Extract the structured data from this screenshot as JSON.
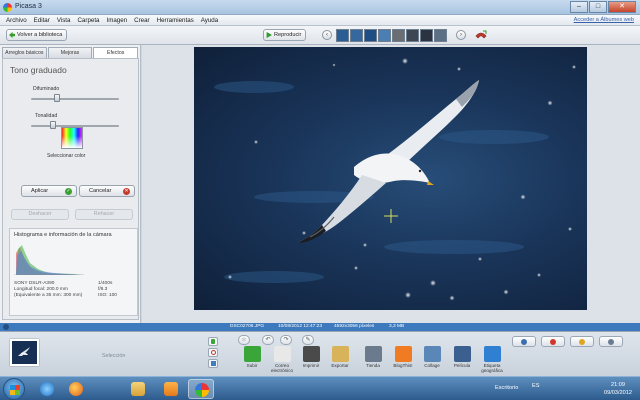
{
  "window": {
    "title": "Picasa 3",
    "controls": {
      "minimize": "–",
      "maximize": "□",
      "close": "✕"
    }
  },
  "menu": {
    "items": [
      "Archivo",
      "Editar",
      "Vista",
      "Carpeta",
      "Imagen",
      "Crear",
      "Herramientas",
      "Ayuda"
    ],
    "signin": "Acceder a Álbumes web"
  },
  "toolbar": {
    "back_label": "Volver a biblioteca",
    "play_label": "Reproducir",
    "prev": "‹",
    "next": "›"
  },
  "edit_panel": {
    "tabs": [
      "Arreglos básicos",
      "Mejoras",
      "Efectos"
    ],
    "active_tab": "Efectos",
    "effect_title": "Tono graduado",
    "slider1_label": "Difuminado",
    "slider1_value": 0.3,
    "slider2_label": "Tonalidad",
    "slider2_value": 0.25,
    "color_label": "Seleccionar color",
    "apply_label": "Aplicar",
    "cancel_label": "Cancelar",
    "undo_label": "Deshacer",
    "redo_label": "Rehacer",
    "histogram_title": "Histograma e información de la cámara",
    "camera": {
      "model": "SONY  DSLR-A390",
      "focal": "Longitud focal: 200.0 mm",
      "equiv": "(Equivalente a 35 mm: 300 mm)",
      "shutter": "1/400s",
      "aperture": "f/8.3",
      "iso": "ISO: 100"
    }
  },
  "info_bar": {
    "filename": "DSC02706.JPG",
    "datetime": "10/08/2012 12:47:23",
    "dimensions": "4592x3056 píxeles",
    "filesize": "3,3 MB"
  },
  "tray": {
    "selection_label": "Selección",
    "tools": [
      {
        "label": "Subir",
        "color": "#3aa63a"
      },
      {
        "label": "Correo electrónico",
        "color": "#e8e8e8"
      },
      {
        "label": "Imprimir",
        "color": "#4a4a4a"
      },
      {
        "label": "Exportar",
        "color": "#d9b35a"
      },
      {
        "label": "Tienda",
        "color": "#6b7a8c"
      },
      {
        "label": "BlogThis!",
        "color": "#f07b22"
      },
      {
        "label": "Collage",
        "color": "#5a87b8"
      },
      {
        "label": "Película",
        "color": "#3b5f8f"
      },
      {
        "label": "Etiqueta geográfica",
        "color": "#2f7fd3"
      }
    ]
  },
  "taskbar": {
    "desktop_label": "Escritorio",
    "language": "ES",
    "time": "21:09",
    "date": "09/03/2012",
    "apps": [
      "ie-icon",
      "firefox-icon",
      "explorer-icon",
      "media-player-icon",
      "picasa-icon"
    ]
  }
}
